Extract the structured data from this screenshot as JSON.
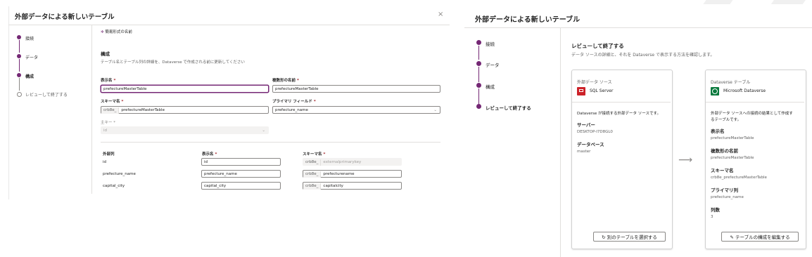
{
  "left_dialog": {
    "title": "外部データによる新しいテーブル",
    "close_glyph": "×",
    "steps": [
      "接続",
      "データ",
      "構成",
      "レビューして終了する"
    ],
    "simple_name_link": "簡易形式の名前",
    "section_title": "構成",
    "section_desc": "テーブル名とテーブル列の詳細を、Dataverse で作成される前に更新してください",
    "display_name_label": "表示名",
    "display_name_value": "prefectureMasterTable",
    "plural_name_label": "複数形の名前",
    "plural_name_value": "prefectureMasterTable",
    "schema_name_label": "スキーマ名",
    "schema_prefix": "crb8e_",
    "schema_name_value": "prefectureMasterTable",
    "primary_field_label": "プライマリ フィールド",
    "primary_field_value": "prefecture_name",
    "primary_key_label": "主キー",
    "primary_key_value": "id",
    "required_mark": "*",
    "columns_header": {
      "external": "外部列",
      "display": "表示名",
      "schema": "スキーマ名"
    },
    "columns": [
      {
        "external": "id",
        "display": "id",
        "prefix": "crb8e_",
        "schema": "externalprimarykey"
      },
      {
        "external": "prefecture_name",
        "display": "prefecture_name",
        "prefix": "crb8e_",
        "schema": "prefecturename"
      },
      {
        "external": "capital_city",
        "display": "capital_city",
        "prefix": "crb8e_",
        "schema": "capitalcity"
      }
    ]
  },
  "right_dialog": {
    "title": "外部データによる新しいテーブル",
    "steps": [
      "接続",
      "データ",
      "構成",
      "レビューして終了する"
    ],
    "review_title": "レビューして終了する",
    "review_desc": "データ ソースの詳細と、それを Dataverse で表示する方法を確認します。",
    "source_card": {
      "heading": "外部データ ソース",
      "connector": "SQL Server",
      "desc": "Dataverse が接続する外部データ ソースです。",
      "server_label": "サーバー",
      "server_value": "DESKTOP-I7D8GL0",
      "db_label": "データベース",
      "db_value": "master",
      "button": "別のテーブルを選択する",
      "button_icon": "↻"
    },
    "arrow": "⟶",
    "dataverse_card": {
      "heading": "Dataverse テーブル",
      "connector": "Microsoft Dataverse",
      "desc_line1": "外部データ ソースへの接続の結果として作成す",
      "desc_line2": "るテーブルです。",
      "display_label": "表示名",
      "display_value": "prefectureMasterTable",
      "plural_label": "複数形の名前",
      "plural_value": "prefectureMasterTable",
      "schema_label": "スキーマ名",
      "schema_value": "crb8e_prefectureMasterTable",
      "primary_label": "プライマリ列",
      "primary_value": "prefecture_name",
      "count_label": "列数",
      "count_value": "3",
      "button": "テーブルの構成を編集する",
      "button_icon": "✎"
    }
  },
  "colors": {
    "accent": "#742774",
    "sql_red": "#cc2229",
    "dataverse_green": "#0b7a3e"
  }
}
